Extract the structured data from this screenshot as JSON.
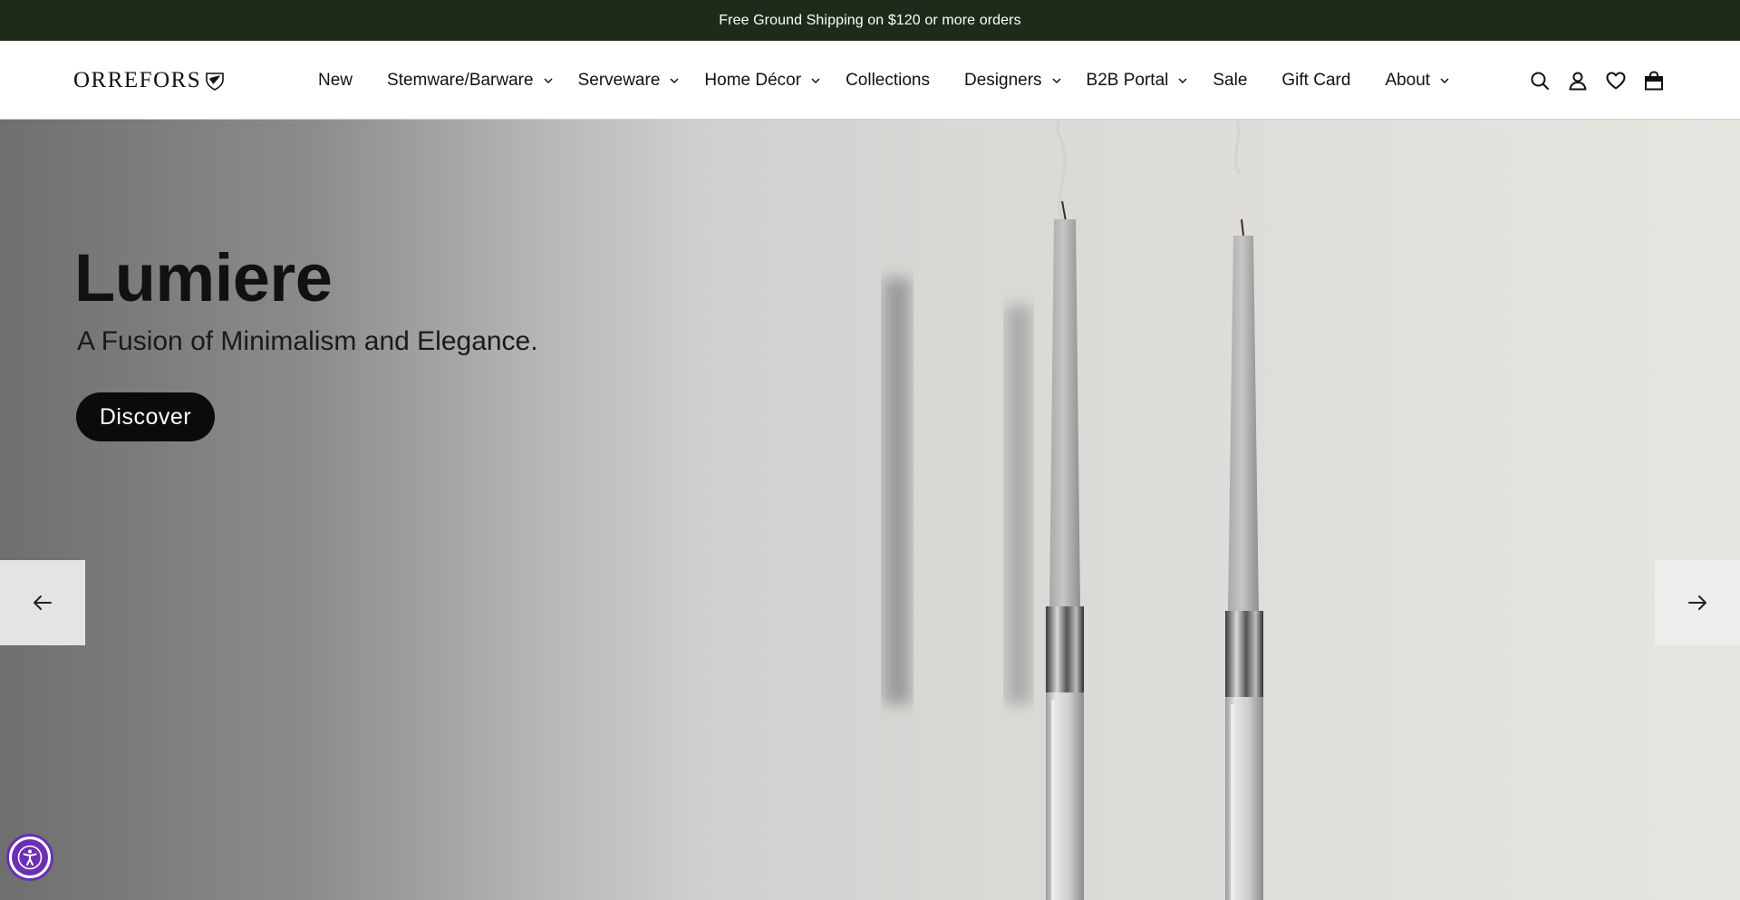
{
  "announcement": {
    "text": "Free Ground Shipping on $120 or more orders"
  },
  "header": {
    "logo_text": "ORREFORS",
    "nav": [
      {
        "label": "New",
        "has_dropdown": false
      },
      {
        "label": "Stemware/Barware",
        "has_dropdown": true
      },
      {
        "label": "Serveware",
        "has_dropdown": true
      },
      {
        "label": "Home Décor",
        "has_dropdown": true
      },
      {
        "label": "Collections",
        "has_dropdown": false
      },
      {
        "label": "Designers",
        "has_dropdown": true
      },
      {
        "label": "B2B Portal",
        "has_dropdown": true
      },
      {
        "label": "Sale",
        "has_dropdown": false
      },
      {
        "label": "Gift Card",
        "has_dropdown": false
      },
      {
        "label": "About",
        "has_dropdown": true
      }
    ],
    "icons": [
      "search-icon",
      "account-icon",
      "wishlist-heart-icon",
      "cart-bag-icon"
    ]
  },
  "hero": {
    "title": "Lumiere",
    "subtitle": "A Fusion of Minimalism and Elegance.",
    "button_label": "Discover",
    "prev_icon": "arrow-left-icon",
    "next_icon": "arrow-right-icon"
  },
  "accessibility": {
    "icon": "accessibility-icon",
    "color": "#6b2fb3"
  },
  "colors": {
    "announcement_bg": "#1e2b1a",
    "button_bg": "#0b0b0b",
    "text": "#111111"
  }
}
